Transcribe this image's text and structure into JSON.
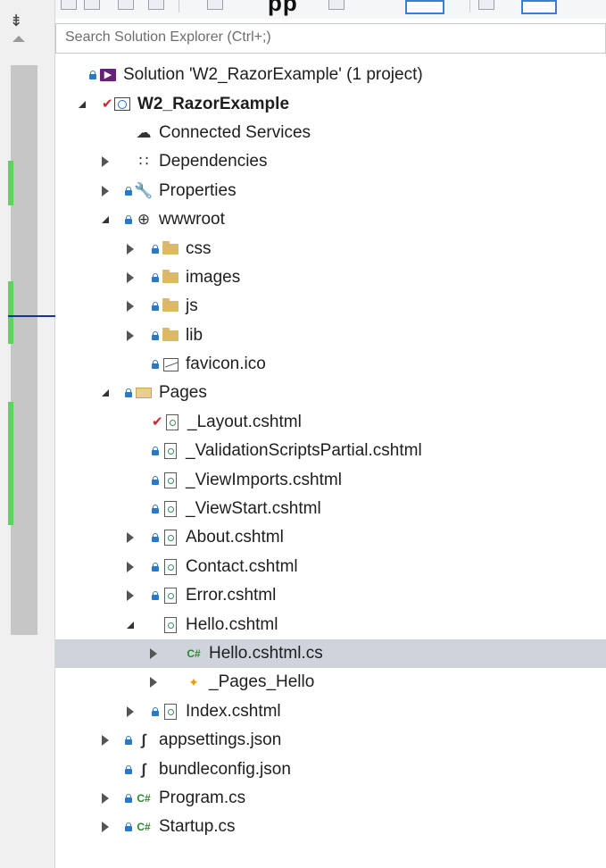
{
  "search": {
    "placeholder": "Search Solution Explorer (Ctrl+;)"
  },
  "toolbar": {
    "partial_text": "pp"
  },
  "colors": {
    "selected_row": "#cfd3dc",
    "lock": "#2a79c7",
    "check": "#d0242b",
    "folder": "#dcb867",
    "scroll_mark": "#5fd35f",
    "position_line": "#1c2f9e"
  },
  "tree": {
    "rows": [
      {
        "label": "Solution 'W2_RazorExample' (1 project)",
        "icon": "solution-icon",
        "arrow": "none",
        "lock": true
      },
      {
        "label": "W2_RazorExample",
        "icon": "project-icon",
        "arrow": "expanded",
        "check": true,
        "bold": true
      },
      {
        "label": "Connected Services",
        "icon": "connected-services-icon",
        "arrow": "none"
      },
      {
        "label": "Dependencies",
        "icon": "dependencies-icon",
        "arrow": "collapsed"
      },
      {
        "label": "Properties",
        "icon": "wrench-icon",
        "arrow": "collapsed",
        "lock": true
      },
      {
        "label": "wwwroot",
        "icon": "globe-icon",
        "arrow": "expanded",
        "lock": true
      },
      {
        "label": "css",
        "icon": "folder-icon",
        "arrow": "collapsed",
        "lock": true
      },
      {
        "label": "images",
        "icon": "folder-icon",
        "arrow": "collapsed",
        "lock": true
      },
      {
        "label": "js",
        "icon": "folder-icon",
        "arrow": "collapsed",
        "lock": true
      },
      {
        "label": "lib",
        "icon": "folder-icon",
        "arrow": "collapsed",
        "lock": true
      },
      {
        "label": "favicon.ico",
        "icon": "image-file-icon",
        "arrow": "none",
        "lock": true
      },
      {
        "label": "Pages",
        "icon": "open-folder-icon",
        "arrow": "expanded",
        "lock": true
      },
      {
        "label": "_Layout.cshtml",
        "icon": "razor-file-icon",
        "arrow": "none",
        "check": true
      },
      {
        "label": "_ValidationScriptsPartial.cshtml",
        "icon": "razor-file-icon",
        "arrow": "none",
        "lock": true
      },
      {
        "label": "_ViewImports.cshtml",
        "icon": "razor-file-icon",
        "arrow": "none",
        "lock": true
      },
      {
        "label": "_ViewStart.cshtml",
        "icon": "razor-file-icon",
        "arrow": "none",
        "lock": true
      },
      {
        "label": "About.cshtml",
        "icon": "razor-file-icon",
        "arrow": "collapsed",
        "lock": true
      },
      {
        "label": "Contact.cshtml",
        "icon": "razor-file-icon",
        "arrow": "collapsed",
        "lock": true
      },
      {
        "label": "Error.cshtml",
        "icon": "razor-file-icon",
        "arrow": "collapsed",
        "lock": true
      },
      {
        "label": "Hello.cshtml",
        "icon": "razor-file-icon",
        "arrow": "expanded"
      },
      {
        "label": "Hello.cshtml.cs",
        "icon": "csharp-file-icon",
        "arrow": "collapsed",
        "selected": true
      },
      {
        "label": "_Pages_Hello",
        "icon": "class-icon",
        "arrow": "collapsed"
      },
      {
        "label": "Index.cshtml",
        "icon": "razor-file-icon",
        "arrow": "collapsed",
        "lock": true
      },
      {
        "label": "appsettings.json",
        "icon": "json-file-icon",
        "arrow": "collapsed",
        "lock": true
      },
      {
        "label": "bundleconfig.json",
        "icon": "json-file-icon",
        "arrow": "none",
        "lock": true
      },
      {
        "label": "Program.cs",
        "icon": "csharp-file-icon",
        "arrow": "collapsed",
        "lock": true
      },
      {
        "label": "Startup.cs",
        "icon": "csharp-file-icon",
        "arrow": "collapsed",
        "lock": true
      }
    ]
  }
}
